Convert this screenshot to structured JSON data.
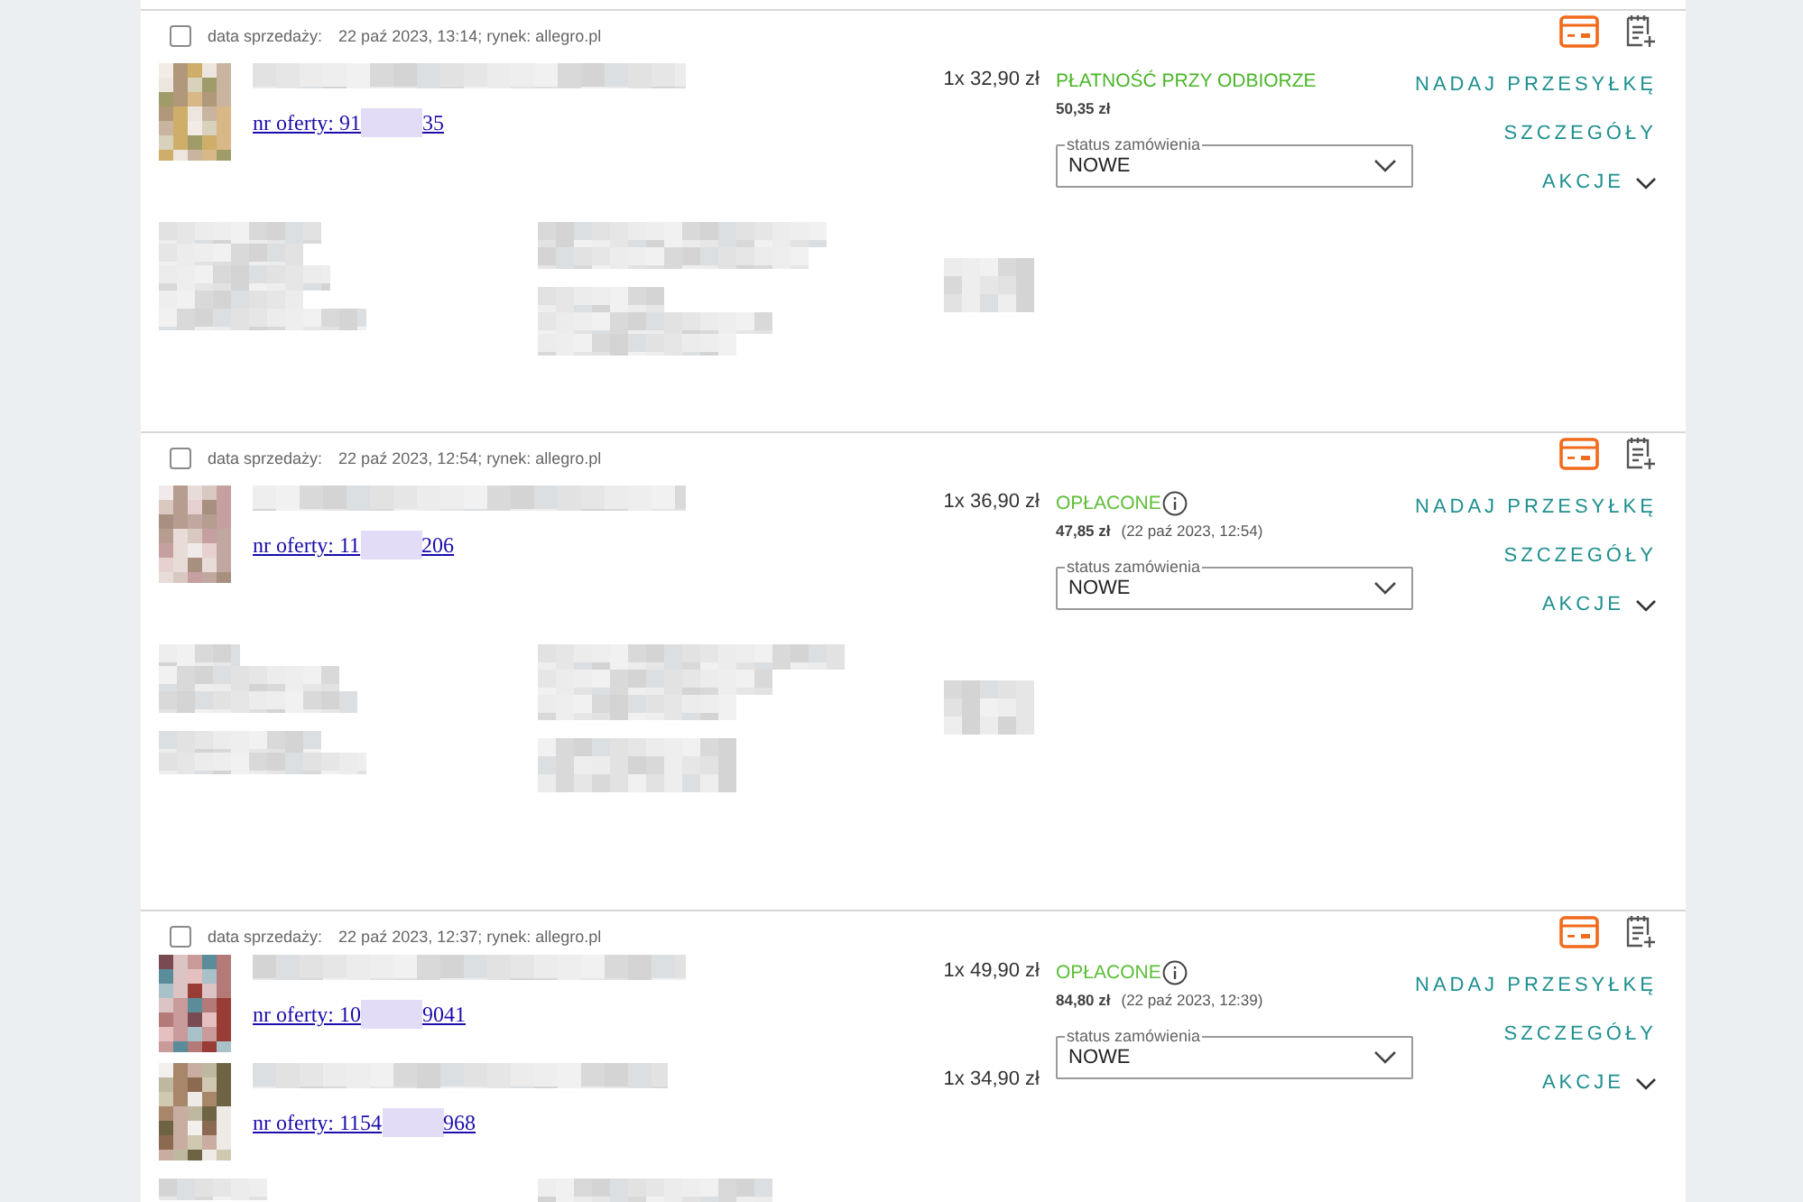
{
  "orders": [
    {
      "checked": false,
      "sale_label": "data sprzedaży:",
      "sale_info": "22 paź 2023, 13:14; rynek: allegro.pl",
      "items": [
        {
          "offer_start": "nr oferty: 91",
          "offer_end": "35",
          "quantity_price": "1x 32,90 zł"
        }
      ],
      "payment": {
        "kind": "cod",
        "text": "PŁATNOŚĆ PRZY ODBIORZE"
      },
      "total": "50,35 zł",
      "status_select": {
        "label": "status zamówienia",
        "value": "NOWE"
      },
      "actions": [
        "NADAJ PRZESYŁKĘ",
        "SZCZEGÓŁY"
      ],
      "menu": "AKCJE"
    },
    {
      "checked": false,
      "sale_label": "data sprzedaży:",
      "sale_info": "22 paź 2023, 12:54; rynek: allegro.pl",
      "items": [
        {
          "offer_start": "nr oferty: 11",
          "offer_end": "206",
          "quantity_price": "1x 36,90 zł"
        }
      ],
      "payment": {
        "kind": "paid",
        "text": "OPŁACONE"
      },
      "total": "47,85 zł",
      "paid_at": "(22 paź 2023, 12:54)",
      "status_select": {
        "label": "status zamówienia",
        "value": "NOWE"
      },
      "actions": [
        "NADAJ PRZESYŁKĘ",
        "SZCZEGÓŁY"
      ],
      "menu": "AKCJE"
    },
    {
      "checked": false,
      "sale_label": "data sprzedaży:",
      "sale_info": "22 paź 2023, 12:37; rynek: allegro.pl",
      "items": [
        {
          "offer_start": "nr oferty: 10",
          "offer_end": "9041",
          "quantity_price": "1x 49,90 zł"
        },
        {
          "offer_start": "nr oferty: 1154",
          "offer_end": "968",
          "quantity_price": "1x 34,90 zł"
        }
      ],
      "payment": {
        "kind": "paid",
        "text": "OPŁACONE"
      },
      "total": "84,80 zł",
      "paid_at": "(22 paź 2023, 12:39)",
      "status_select": {
        "label": "status zamówienia",
        "value": "NOWE"
      },
      "actions": [
        "NADAJ PRZESYŁKĘ",
        "SZCZEGÓŁY"
      ],
      "menu": "AKCJE"
    }
  ]
}
